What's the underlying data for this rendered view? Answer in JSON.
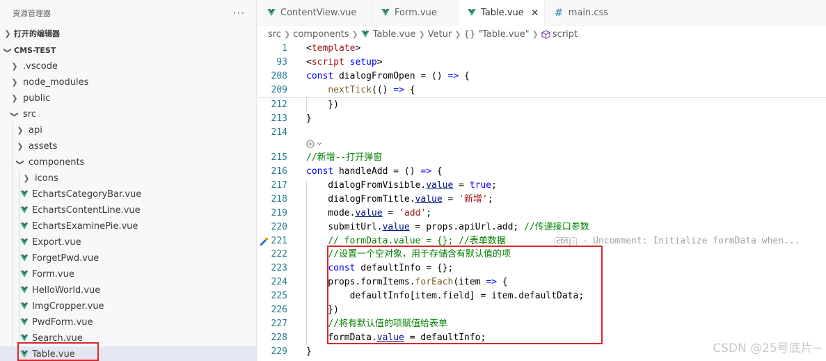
{
  "sidebar": {
    "title": "资源管理器",
    "more_label": "···",
    "open_editors": "打开的编辑器",
    "project": "CMS-TEST",
    "items": [
      {
        "label": ".vscode",
        "type": "folder"
      },
      {
        "label": "node_modules",
        "type": "folder"
      },
      {
        "label": "public",
        "type": "folder"
      },
      {
        "label": "src",
        "type": "folder-open"
      },
      {
        "label": "api",
        "type": "folder"
      },
      {
        "label": "assets",
        "type": "folder"
      },
      {
        "label": "components",
        "type": "folder-open"
      },
      {
        "label": "icons",
        "type": "folder"
      },
      {
        "label": "EchartsCategoryBar.vue",
        "type": "vue"
      },
      {
        "label": "EchartsContentLine.vue",
        "type": "vue"
      },
      {
        "label": "EchartsExaminePie.vue",
        "type": "vue"
      },
      {
        "label": "Export.vue",
        "type": "vue"
      },
      {
        "label": "ForgetPwd.vue",
        "type": "vue"
      },
      {
        "label": "Form.vue",
        "type": "vue"
      },
      {
        "label": "HelloWorld.vue",
        "type": "vue"
      },
      {
        "label": "ImgCropper.vue",
        "type": "vue"
      },
      {
        "label": "PwdForm.vue",
        "type": "vue"
      },
      {
        "label": "Search.vue",
        "type": "vue"
      },
      {
        "label": "Table.vue",
        "type": "vue",
        "selected": true
      }
    ]
  },
  "tabs": [
    {
      "label": "ContentView.vue",
      "icon": "vue-icon"
    },
    {
      "label": "Form.vue",
      "icon": "vue-icon"
    },
    {
      "label": "Table.vue",
      "icon": "vue-icon",
      "active": true,
      "close": "✕"
    },
    {
      "label": "main.css",
      "icon": "hash-icon",
      "icon_glyph": "#"
    }
  ],
  "breadcrumb": {
    "src": "src",
    "components": "components",
    "file": "Table.vue",
    "vetur": "Vetur",
    "braces": "{}",
    "symbol": "\"Table.vue\"",
    "script": "script"
  },
  "editor": {
    "copilot_icon": "copilot-icon",
    "ghost_text": "- Uncomment: Initialize formData when...",
    "ghost_key1": "ctrl",
    "ghost_key2": ";",
    "lines": [
      {
        "n": "1",
        "t": "<template>"
      },
      {
        "n": "93",
        "t": "<script setup>"
      },
      {
        "n": "208",
        "t": "const dialogFromOpen = () => {"
      },
      {
        "n": "209",
        "t": "    nextTick(() => {"
      },
      {
        "n": "212",
        "t": "    })"
      },
      {
        "n": "213",
        "t": "}"
      },
      {
        "n": "214",
        "t": ""
      },
      {
        "n": "215",
        "t": "//新增--打开弹窗"
      },
      {
        "n": "216",
        "t": "const handleAdd = () => {"
      },
      {
        "n": "217",
        "t": "    dialogFromVisible.value = true;"
      },
      {
        "n": "218",
        "t": "    dialogFromTitle.value = '新增';"
      },
      {
        "n": "219",
        "t": "    mode.value = 'add';"
      },
      {
        "n": "220",
        "t": "    submitUrl.value = props.apiUrl.add; //传递接口参数"
      },
      {
        "n": "221",
        "t": "    // formData.value = {}; //表单数据"
      },
      {
        "n": "222",
        "t": "    //设置一个空对象，用于存储含有默认值的项"
      },
      {
        "n": "223",
        "t": "    const defaultInfo = {};"
      },
      {
        "n": "224",
        "t": "    props.formItems.forEach(item => {"
      },
      {
        "n": "225",
        "t": "        defaultInfo[item.field] = item.defaultData;"
      },
      {
        "n": "226",
        "t": "    })"
      },
      {
        "n": "227",
        "t": "    //将有默认值的项赋值给表单"
      },
      {
        "n": "228",
        "t": "    formData.value = defaultInfo;"
      },
      {
        "n": "229",
        "t": "}"
      }
    ]
  },
  "watermark": "CSDN @25号底片~",
  "colors": {
    "accent_green": "#41b883",
    "highlight_red": "#d9262a",
    "line_number": "#237893",
    "keyword": "#0000ff",
    "comment": "#008000",
    "string": "#a31515"
  }
}
